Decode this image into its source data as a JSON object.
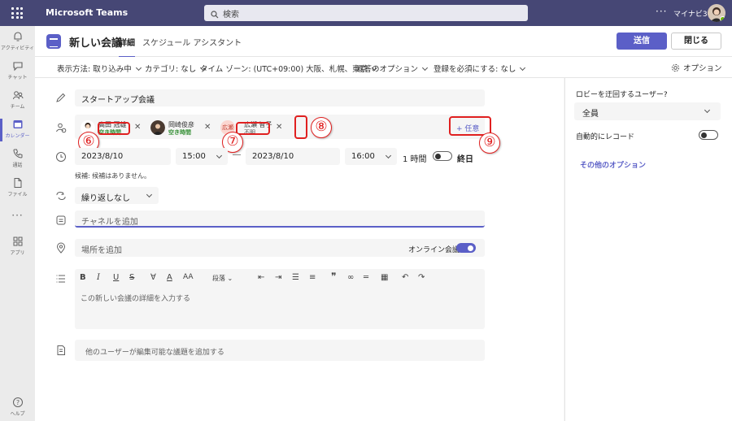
{
  "topbar": {
    "app_title": "Microsoft Teams",
    "search_placeholder": "検索",
    "more": "···",
    "user_name": "マイナビ365"
  },
  "rail": [
    {
      "label": "アクティビティ",
      "icon": "bell-icon"
    },
    {
      "label": "チャット",
      "icon": "chat-icon"
    },
    {
      "label": "チーム",
      "icon": "teams-icon"
    },
    {
      "label": "カレンダー",
      "icon": "calendar-icon"
    },
    {
      "label": "通話",
      "icon": "phone-icon"
    },
    {
      "label": "ファイル",
      "icon": "file-icon"
    },
    {
      "label": "···",
      "icon": "more-icon"
    },
    {
      "label": "アプリ",
      "icon": "apps-icon"
    },
    {
      "label": "ヘルプ",
      "icon": "help-icon"
    }
  ],
  "header": {
    "title": "新しい会議",
    "tab_details": "詳細",
    "tab_assistant": "スケジュール アシスタント",
    "send": "送信",
    "close": "閉じる"
  },
  "options": {
    "show_as": "表示方法: 取り込み中",
    "category": "カテゴリ: なし",
    "timezone": "タイム ゾーン: (UTC+09:00) 大阪、札幌、東京",
    "response": "返答のオプション",
    "registration": "登録を必須にする: なし",
    "options_label": "オプション"
  },
  "form": {
    "title_value": "スタートアップ会議",
    "attendees": [
      {
        "name": "高田 冠雄",
        "status": "空き時間"
      },
      {
        "name": "岡崎俊彦",
        "status": "空き時間"
      },
      {
        "name": "広瀬 智子",
        "status": "不明",
        "initials": "広瀬"
      }
    ],
    "optional_label": "+ 任意",
    "start_date": "2023/8/10",
    "start_time": "15:00",
    "end_date": "2023/8/10",
    "end_time": "16:00",
    "duration": "1 時間",
    "allday": "終日",
    "suggestions": "候補: 候補はありません。",
    "repeat": "繰り返しなし",
    "channel_placeholder": "チャネルを追加",
    "location_placeholder": "場所を追加",
    "online_label": "オンライン会議",
    "paragraph_label": "段落",
    "details_placeholder": "この新しい会議の詳細を入力する",
    "agenda_placeholder": "他のユーザーが編集可能な議題を追加する"
  },
  "annotations": [
    "⑥",
    "⑦",
    "⑧",
    "⑨"
  ],
  "side": {
    "bypass_label": "ロビーを迂回するユーザー?",
    "bypass_value": "全員",
    "record_label": "自動的にレコード",
    "more_options": "その他のオプション"
  },
  "colors": {
    "brand": "#5b5fc7",
    "topbar": "#464775",
    "annotation": "#e02020",
    "available": "#2e8b2e"
  }
}
